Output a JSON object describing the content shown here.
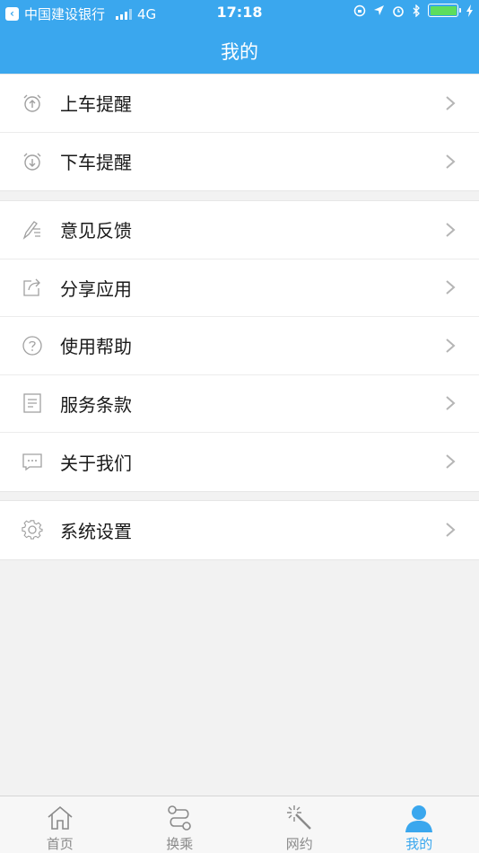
{
  "status_bar": {
    "carrier": "中国建设银行",
    "network": "4G",
    "time": "17:18"
  },
  "header": {
    "title": "我的"
  },
  "groups": [
    {
      "items": [
        {
          "label": "上车提醒",
          "icon": "alarm-up-icon"
        },
        {
          "label": "下车提醒",
          "icon": "alarm-down-icon"
        }
      ]
    },
    {
      "items": [
        {
          "label": "意见反馈",
          "icon": "feedback-pen-icon"
        },
        {
          "label": "分享应用",
          "icon": "share-icon"
        },
        {
          "label": "使用帮助",
          "icon": "help-icon"
        },
        {
          "label": "服务条款",
          "icon": "terms-document-icon"
        },
        {
          "label": "关于我们",
          "icon": "chat-bubble-icon"
        }
      ]
    },
    {
      "items": [
        {
          "label": "系统设置",
          "icon": "gear-icon"
        }
      ]
    }
  ],
  "tabbar": {
    "tabs": [
      {
        "label": "首页",
        "icon": "home-icon",
        "active": false
      },
      {
        "label": "换乘",
        "icon": "transfer-icon",
        "active": false
      },
      {
        "label": "网约",
        "icon": "magic-wand-icon",
        "active": false
      },
      {
        "label": "我的",
        "icon": "user-icon",
        "active": true
      }
    ]
  },
  "colors": {
    "accent": "#3aa7ee",
    "icon_gray": "#9a9a9a"
  }
}
